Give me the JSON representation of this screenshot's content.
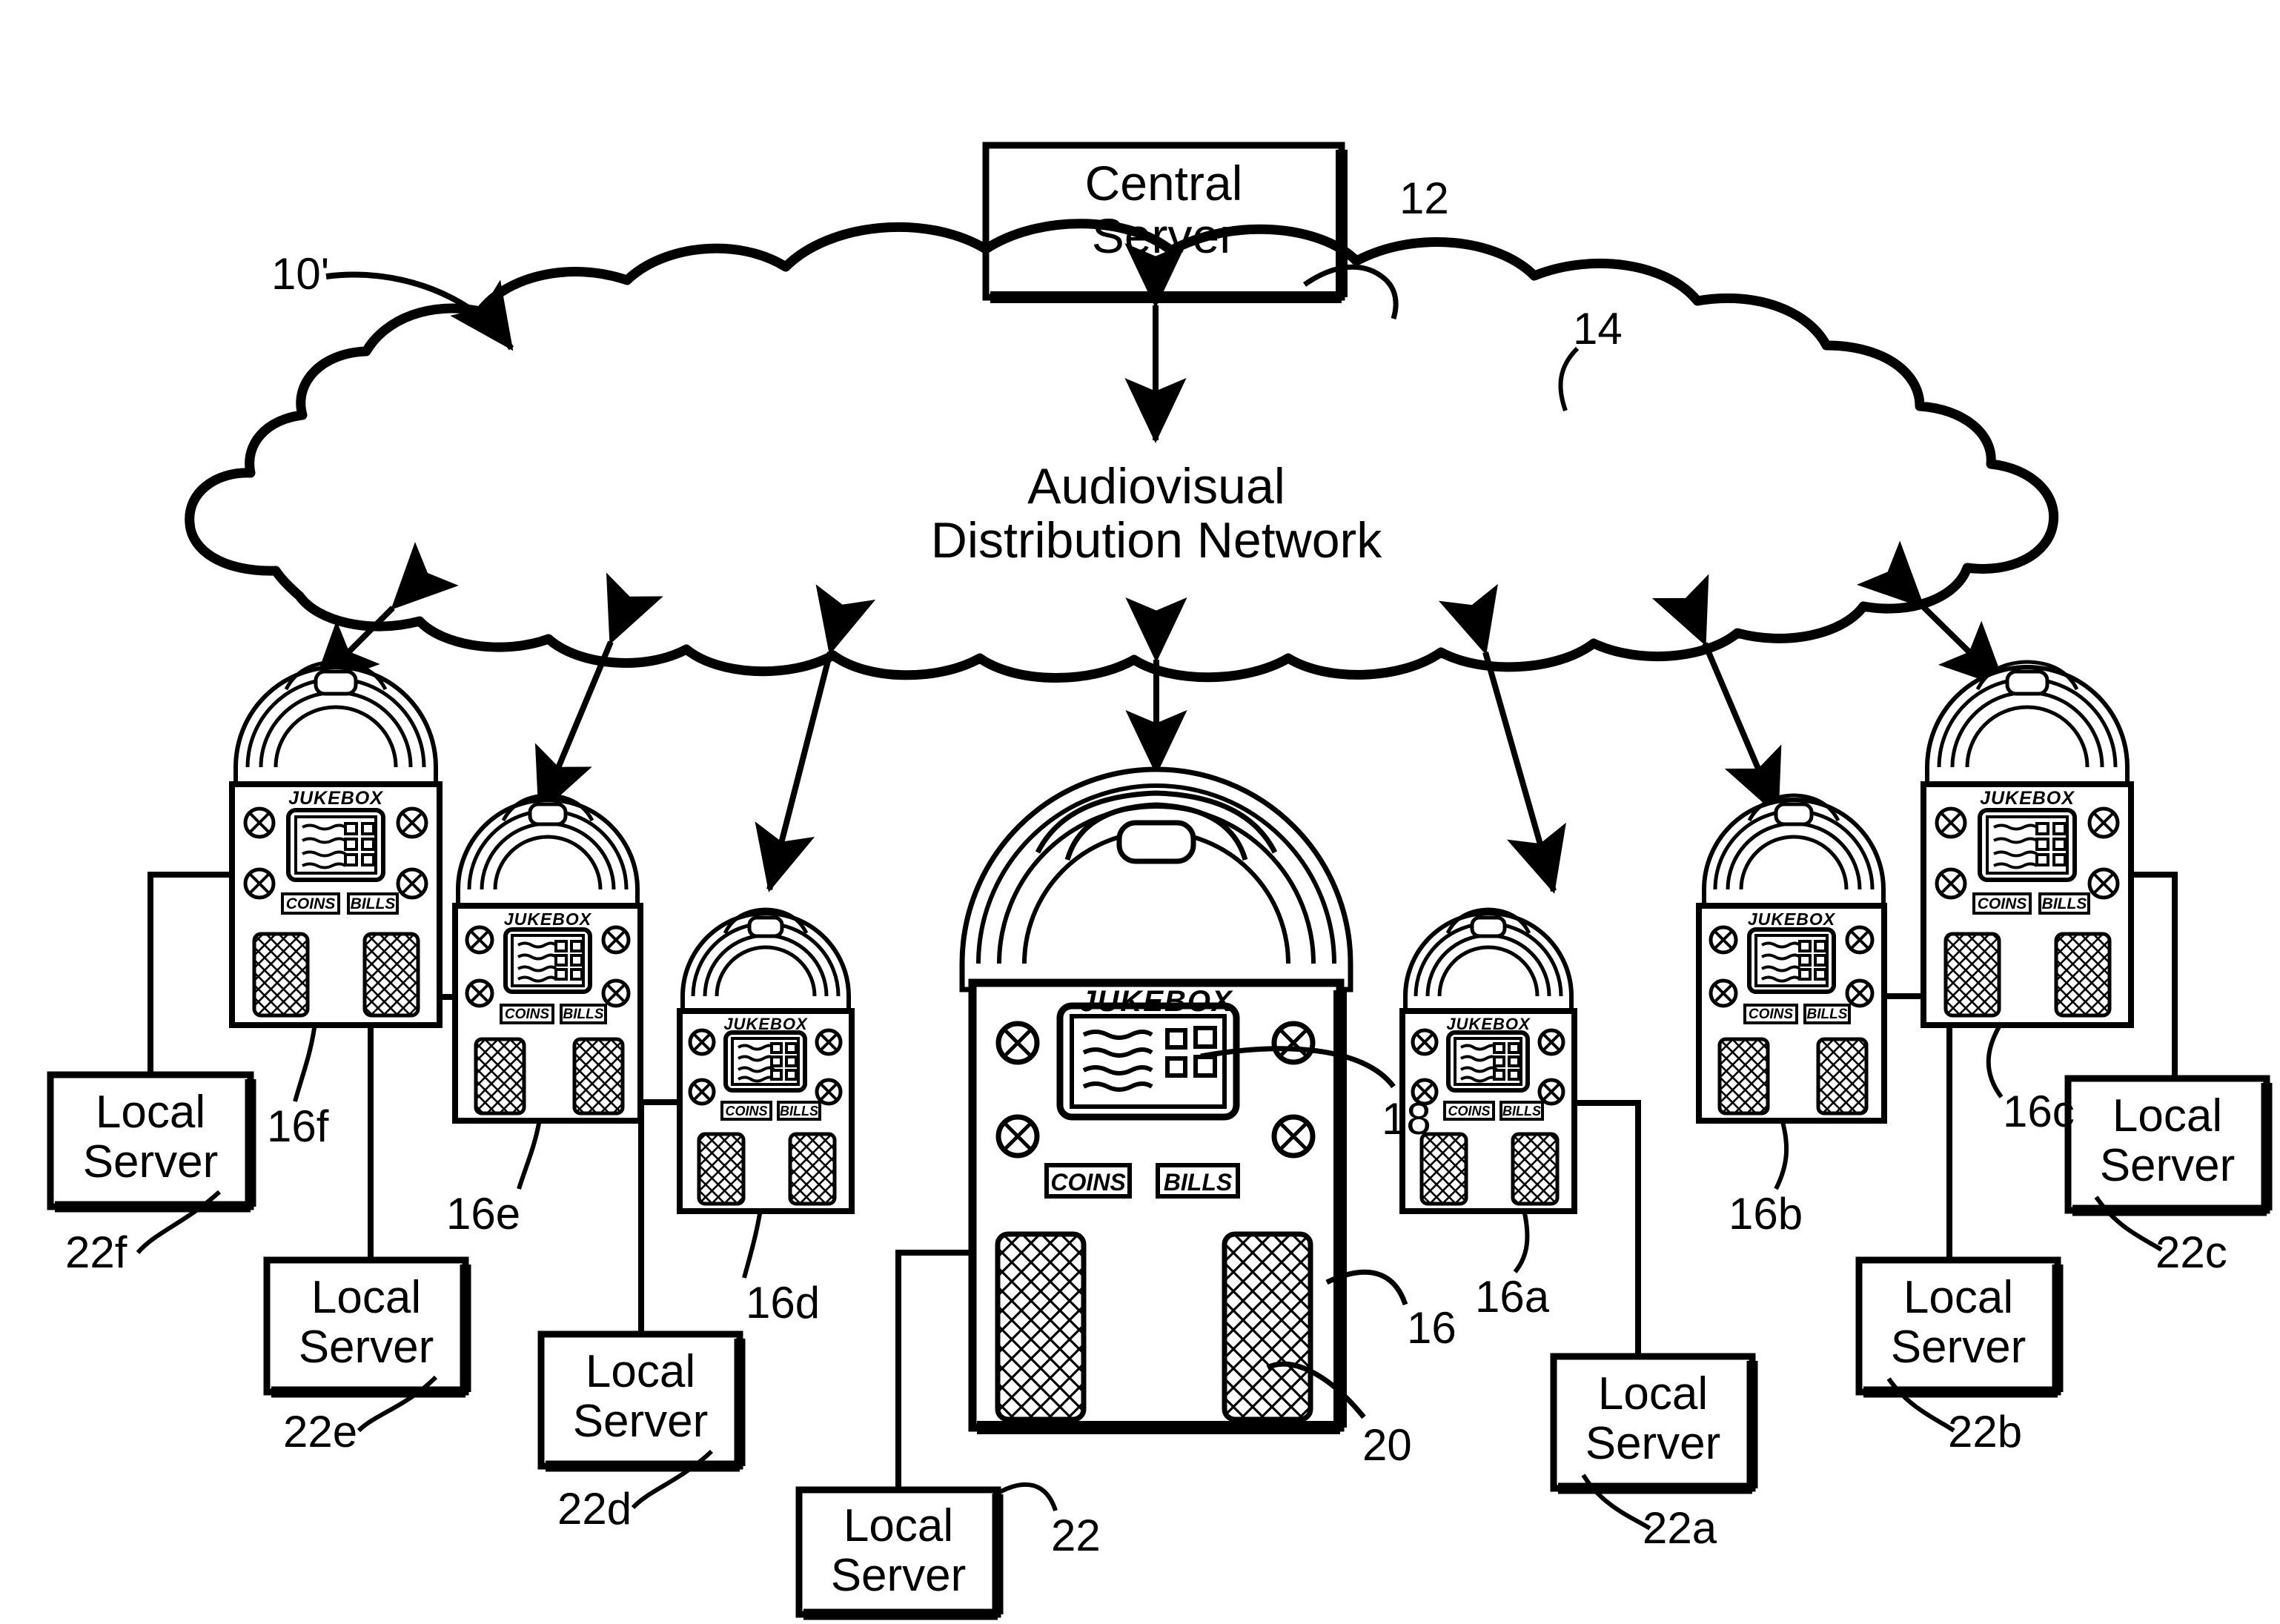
{
  "figure": {
    "type": "patent-network-diagram",
    "figure_ref": "10'",
    "background": "#ffffff",
    "ink": "#000000"
  },
  "central_server": {
    "line1": "Central",
    "line2": "Server",
    "ref": "12"
  },
  "network_cloud": {
    "line1": "Audiovisual",
    "line2": "Distribution Network",
    "ref": "14"
  },
  "jukebox_face": {
    "title": "JUKEBOX",
    "coins_label": "COINS",
    "bills_label": "BILLS"
  },
  "main_jukebox": {
    "ref": "16",
    "screen_ref": "18",
    "speaker_ref": "20",
    "title": "JUKEBOX",
    "coins_label": "COINS",
    "bills_label": "BILLS"
  },
  "local_servers": [
    {
      "id": "ls_main",
      "line1": "Local",
      "line2": "Server",
      "ref": "22"
    },
    {
      "id": "ls_a",
      "line1": "Local",
      "line2": "Server",
      "ref": "22a"
    },
    {
      "id": "ls_b",
      "line1": "Local",
      "line2": "Server",
      "ref": "22b"
    },
    {
      "id": "ls_c",
      "line1": "Local",
      "line2": "Server",
      "ref": "22c"
    },
    {
      "id": "ls_d",
      "line1": "Local",
      "line2": "Server",
      "ref": "22d"
    },
    {
      "id": "ls_e",
      "line1": "Local",
      "line2": "Server",
      "ref": "22e"
    },
    {
      "id": "ls_f",
      "line1": "Local",
      "line2": "Server",
      "ref": "22f"
    }
  ],
  "jukeboxes": [
    {
      "id": "jb_a",
      "ref": "16a"
    },
    {
      "id": "jb_b",
      "ref": "16b"
    },
    {
      "id": "jb_c",
      "ref": "16c"
    },
    {
      "id": "jb_d",
      "ref": "16d"
    },
    {
      "id": "jb_e",
      "ref": "16e"
    },
    {
      "id": "jb_f",
      "ref": "16f"
    }
  ],
  "ref_numbers": {
    "figure": "10'",
    "central_server": "12",
    "network": "14",
    "main_jukebox": "16",
    "jukebox_a": "16a",
    "jukebox_b": "16b",
    "jukebox_c": "16c",
    "jukebox_d": "16d",
    "jukebox_e": "16e",
    "jukebox_f": "16f",
    "screen": "18",
    "speaker": "20",
    "local_server": "22",
    "local_server_a": "22a",
    "local_server_b": "22b",
    "local_server_c": "22c",
    "local_server_d": "22d",
    "local_server_e": "22e",
    "local_server_f": "22f"
  }
}
